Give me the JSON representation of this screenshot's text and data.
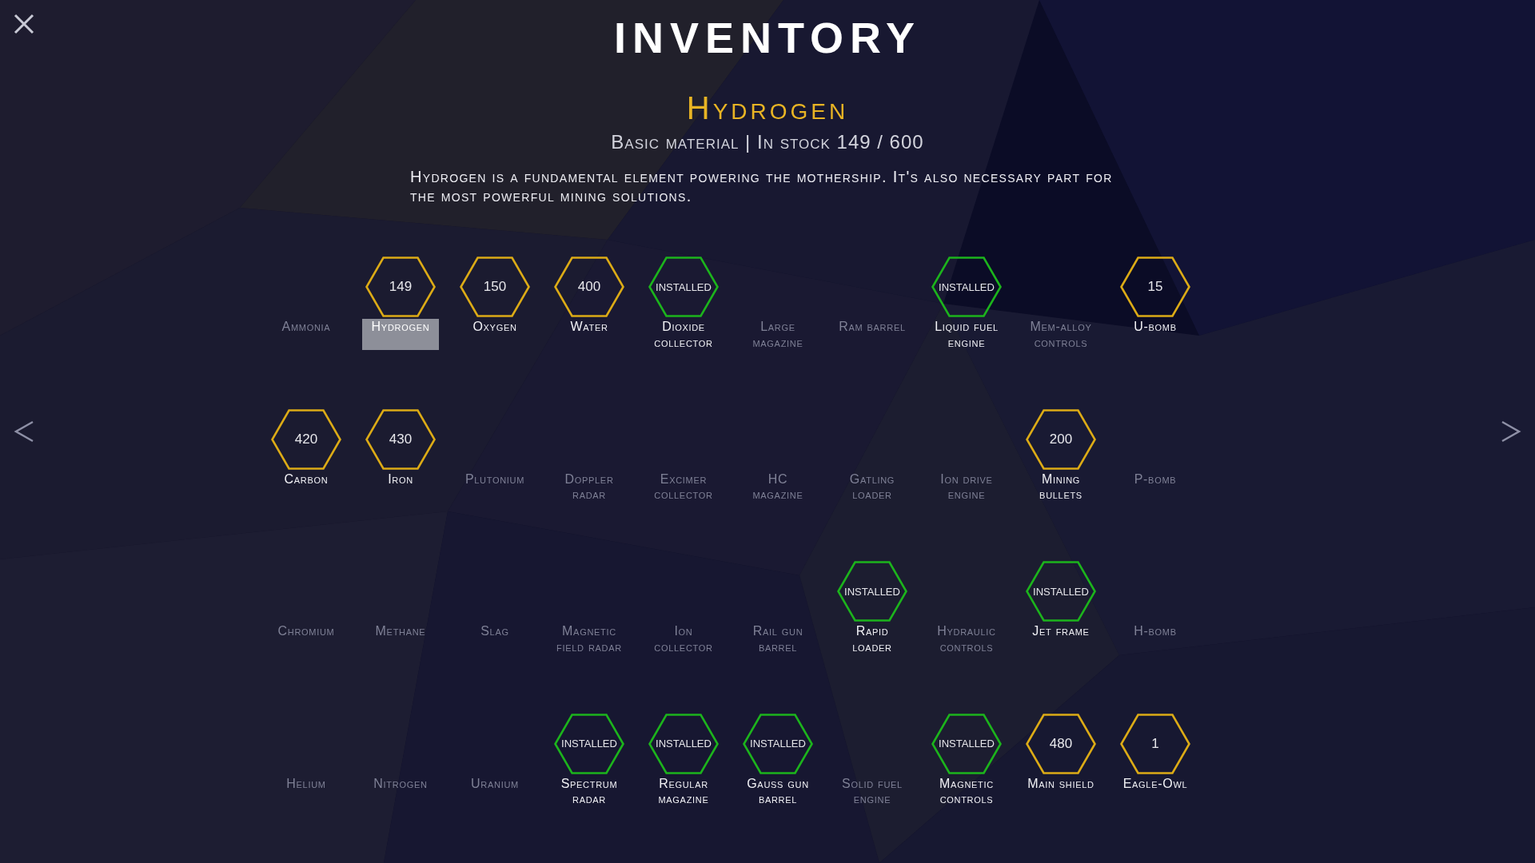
{
  "window": {
    "title": "INVENTORY"
  },
  "detail": {
    "name": "Hydrogen",
    "subtitle": "Basic material | In stock 149 / 600",
    "description": "Hydrogen is a fundamental element powering the mothership. It's also necessary part for the most powerful mining solutions."
  },
  "items": [
    {
      "name": "Ammonia",
      "kind": "missing",
      "selected": false
    },
    {
      "name": "Hydrogen",
      "kind": "stock",
      "badge": "149",
      "selected": true
    },
    {
      "name": "Oxygen",
      "kind": "stock",
      "badge": "150",
      "selected": false
    },
    {
      "name": "Water",
      "kind": "stock",
      "badge": "400",
      "selected": false
    },
    {
      "name": "Dioxide\ncollector",
      "kind": "installed",
      "badge": "INSTALLED",
      "selected": false
    },
    {
      "name": "Large\nmagazine",
      "kind": "missing",
      "selected": false
    },
    {
      "name": "Ram barrel",
      "kind": "missing",
      "selected": false
    },
    {
      "name": "Liquid fuel\nengine",
      "kind": "installed",
      "badge": "INSTALLED",
      "selected": false
    },
    {
      "name": "Mem-alloy\ncontrols",
      "kind": "missing",
      "selected": false
    },
    {
      "name": "U-bomb",
      "kind": "stock",
      "badge": "15",
      "selected": false
    },
    {
      "name": "Carbon",
      "kind": "stock",
      "badge": "420",
      "selected": false
    },
    {
      "name": "Iron",
      "kind": "stock",
      "badge": "430",
      "selected": false
    },
    {
      "name": "Plutonium",
      "kind": "missing",
      "selected": false
    },
    {
      "name": "Doppler\nradar",
      "kind": "missing",
      "selected": false
    },
    {
      "name": "Excimer\ncollector",
      "kind": "missing",
      "selected": false
    },
    {
      "name": "HC\nmagazine",
      "kind": "missing",
      "selected": false
    },
    {
      "name": "Gatling\nloader",
      "kind": "missing",
      "selected": false
    },
    {
      "name": "Ion drive\nengine",
      "kind": "missing",
      "selected": false
    },
    {
      "name": "Mining\nbullets",
      "kind": "stock",
      "badge": "200",
      "selected": false
    },
    {
      "name": "P-bomb",
      "kind": "missing",
      "selected": false
    },
    {
      "name": "Chromium",
      "kind": "missing",
      "selected": false
    },
    {
      "name": "Methane",
      "kind": "missing",
      "selected": false
    },
    {
      "name": "Slag",
      "kind": "missing",
      "selected": false
    },
    {
      "name": "Magnetic\nfield radar",
      "kind": "missing",
      "selected": false
    },
    {
      "name": "Ion\ncollector",
      "kind": "missing",
      "selected": false
    },
    {
      "name": "Rail gun\nbarrel",
      "kind": "missing",
      "selected": false
    },
    {
      "name": "Rapid\nloader",
      "kind": "installed",
      "badge": "INSTALLED",
      "selected": false
    },
    {
      "name": "Hydraulic\ncontrols",
      "kind": "missing",
      "selected": false
    },
    {
      "name": "Jet frame",
      "kind": "installed",
      "badge": "INSTALLED",
      "selected": false
    },
    {
      "name": "H-bomb",
      "kind": "missing",
      "selected": false
    },
    {
      "name": "Helium",
      "kind": "missing",
      "selected": false
    },
    {
      "name": "Nitrogen",
      "kind": "missing",
      "selected": false
    },
    {
      "name": "Uranium",
      "kind": "missing",
      "selected": false
    },
    {
      "name": "Spectrum\nradar",
      "kind": "installed",
      "badge": "INSTALLED",
      "selected": false
    },
    {
      "name": "Regular\nmagazine",
      "kind": "installed",
      "badge": "INSTALLED",
      "selected": false
    },
    {
      "name": "Gauss gun\nbarrel",
      "kind": "installed",
      "badge": "INSTALLED",
      "selected": false
    },
    {
      "name": "Solid fuel\nengine",
      "kind": "missing",
      "selected": false
    },
    {
      "name": "Magnetic\ncontrols",
      "kind": "installed",
      "badge": "INSTALLED",
      "selected": false
    },
    {
      "name": "Main shield",
      "kind": "stock",
      "badge": "480",
      "selected": false
    },
    {
      "name": "Eagle-Owl",
      "kind": "stock",
      "badge": "1",
      "selected": false
    }
  ]
}
